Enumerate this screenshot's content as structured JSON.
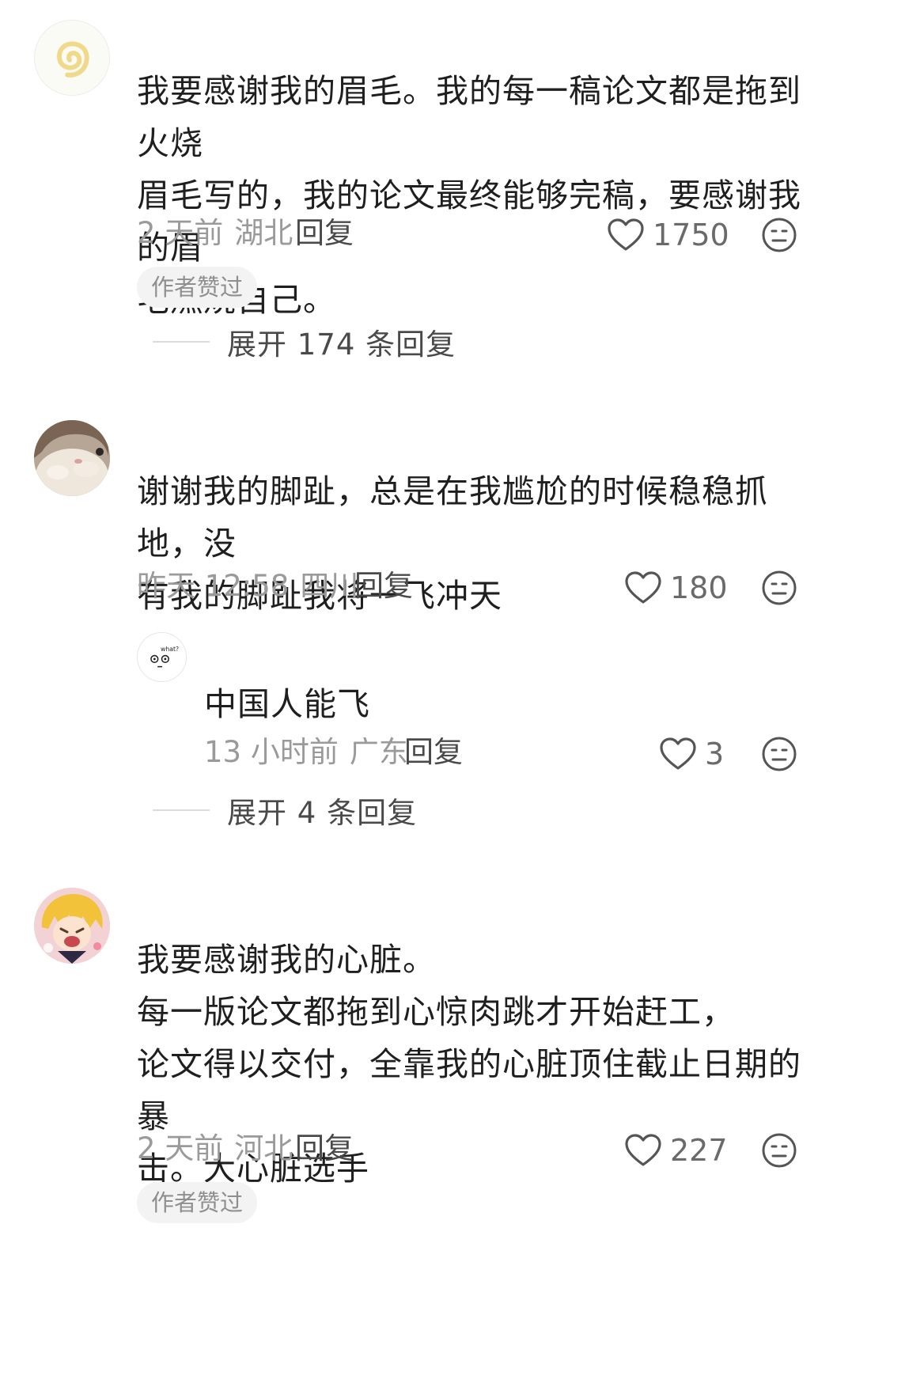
{
  "comments": [
    {
      "text": "我要感谢我的眉毛。我的每一稿论文都是拖到火烧\n眉毛写的，我的论文最终能够完稿，要感谢我的眉\n毛燃烧自己。",
      "time": "2 天前",
      "location": "湖北",
      "reply_label": "回复",
      "likes": "1750",
      "badge": "作者赞过",
      "expand_label": "展开 174 条回复"
    },
    {
      "text": "谢谢我的脚趾，总是在我尴尬的时候稳稳抓地，没\n有我的脚趾我将一飞冲天",
      "time": "昨天 12:58",
      "location": "四川",
      "reply_label": "回复",
      "likes": "180",
      "sub_reply": {
        "text": "中国人能飞",
        "avatar_text": "what?",
        "time": "13 小时前",
        "location": "广东",
        "reply_label": "回复",
        "likes": "3"
      },
      "expand_label": "展开 4 条回复"
    },
    {
      "text": "我要感谢我的心脏。\n每一版论文都拖到心惊肉跳才开始赶工，\n论文得以交付，全靠我的心脏顶住截止日期的暴\n击。大心脏选手",
      "time": "2 天前",
      "location": "河北",
      "reply_label": "回复",
      "likes": "227",
      "badge": "作者赞过"
    }
  ],
  "icons": {
    "like": "heart-outline-icon",
    "emoji": "neutral-face-icon"
  },
  "colors": {
    "text": "#1f1f1f",
    "meta": "#9a9a9a",
    "badge_bg": "#f3f3f3"
  }
}
